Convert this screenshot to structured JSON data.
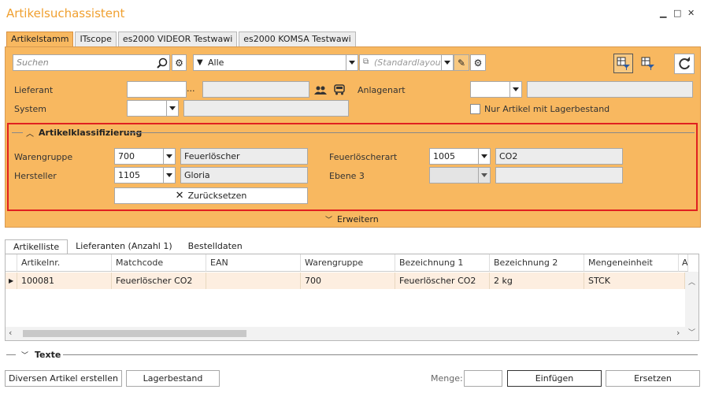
{
  "window": {
    "title": "Artikelsuchassistent",
    "minimize": "▁",
    "maximize": "□",
    "close": "✕"
  },
  "tabs": [
    "Artikelstamm",
    "ITscope",
    "es2000 VIDEOR Testwawi",
    "es2000 KOMSA Testwawi"
  ],
  "toolbar": {
    "search_placeholder": "Suchen",
    "filter_value": "Alle",
    "layout_value": "(Standardlayout)"
  },
  "fields": {
    "lieferant_label": "Lieferant",
    "lieferant_ellipsis": "...",
    "anlagenart_label": "Anlagenart",
    "system_label": "System",
    "nur_lager_label": "Nur Artikel mit Lagerbestand"
  },
  "klassifizierung": {
    "header": "Artikelklassifizierung",
    "warengruppe_label": "Warengruppe",
    "warengruppe_code": "700",
    "warengruppe_name": "Feuerlöscher",
    "hersteller_label": "Hersteller",
    "hersteller_code": "1105",
    "hersteller_name": "Gloria",
    "feuerloescherart_label": "Feuerlöscherart",
    "feuerloescherart_code": "1005",
    "feuerloescherart_name": "CO2",
    "ebene3_label": "Ebene 3",
    "reset_label": "Zurücksetzen"
  },
  "erweitern_label": "Erweitern",
  "bottom_tabs": [
    "Artikelliste",
    "Lieferanten (Anzahl 1)",
    "Bestelldaten"
  ],
  "grid": {
    "columns": [
      "Artikelnr.",
      "Matchcode",
      "EAN",
      "Warengruppe",
      "Bezeichnung 1",
      "Bezeichnung 2",
      "Mengeneinheit",
      "A"
    ],
    "rows": [
      [
        "100081",
        "Feuerlöscher CO2",
        "",
        "700",
        "Feuerlöscher CO2",
        "2 kg",
        "STCK"
      ]
    ]
  },
  "texte_label": "Texte",
  "footer": {
    "diversen_label": "Diversen Artikel erstellen",
    "lagerbestand_label": "Lagerbestand",
    "menge_label": "Menge:",
    "einfuegen_label": "Einfügen",
    "ersetzen_label": "Ersetzen"
  }
}
